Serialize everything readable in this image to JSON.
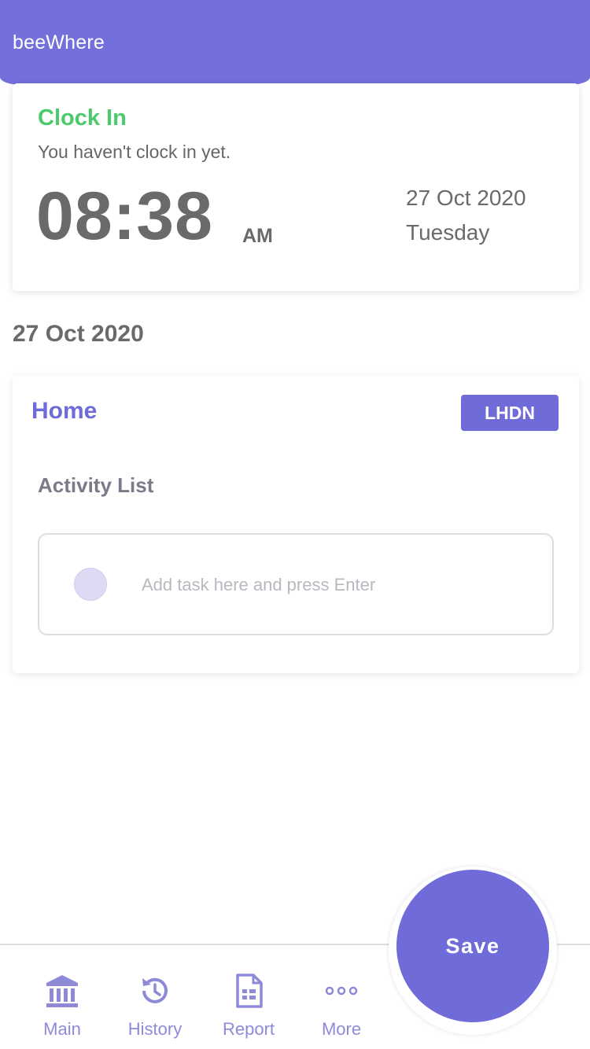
{
  "app": {
    "title": "beeWhere"
  },
  "clock": {
    "label": "Clock In",
    "status": "You haven't clock in yet.",
    "time": "08:38",
    "ampm": "AM",
    "date": "27 Oct 2020",
    "day": "Tuesday"
  },
  "section": {
    "date": "27 Oct 2020"
  },
  "activity": {
    "location": "Home",
    "tag": "LHDN",
    "heading": "Activity List",
    "task_placeholder": "Add task here and press Enter",
    "task_value": ""
  },
  "actions": {
    "save_label": "Save"
  },
  "nav": {
    "items": [
      {
        "label": "Main",
        "icon": "bank-icon"
      },
      {
        "label": "History",
        "icon": "history-icon"
      },
      {
        "label": "Report",
        "icon": "report-icon"
      },
      {
        "label": "More",
        "icon": "more-icon"
      }
    ]
  },
  "colors": {
    "brand": "#7370db",
    "accent": "#6f6bd8",
    "clock_in_green": "#4ccb6c",
    "nav_label": "#8e8ad8"
  }
}
